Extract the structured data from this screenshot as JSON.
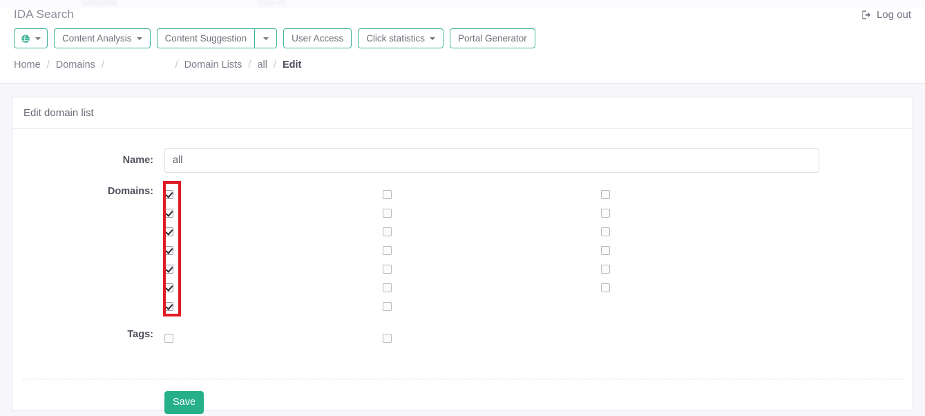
{
  "ghost": {
    "item1": "Unmerkt",
    "item2": "Ctrl+H"
  },
  "header": {
    "brand": "IDA Search",
    "user_email_redacted": "                                  ",
    "logout_label": "Log out",
    "logout_icon": "sign-out-icon"
  },
  "toolbar": {
    "globe_icon": "globe-icon",
    "globe_label": "",
    "buttons": [
      {
        "label": "Content Analysis",
        "caret": true
      },
      {
        "label": "Content Suggestion",
        "caret": false
      },
      {
        "label": "",
        "caret": true
      },
      {
        "label": "User Access",
        "caret": false
      },
      {
        "label": "Click statistics",
        "caret": true
      },
      {
        "label": "Portal Generator",
        "caret": false
      }
    ]
  },
  "breadcrumb": {
    "separator": "/",
    "items": [
      {
        "label": "Home",
        "redacted": false,
        "current": false
      },
      {
        "label": "Domains",
        "redacted": false,
        "current": false
      },
      {
        "label": "                     ",
        "redacted": true,
        "current": false
      },
      {
        "label": "Domain Lists",
        "redacted": false,
        "current": false
      },
      {
        "label": "all",
        "redacted": false,
        "current": false
      },
      {
        "label": "Edit",
        "redacted": false,
        "current": true
      }
    ]
  },
  "panel": {
    "title": "Edit domain list"
  },
  "form": {
    "name": {
      "label": "Name:",
      "value": "all",
      "placeholder": ""
    },
    "domains": {
      "label": "Domains:",
      "columns": [
        {
          "items": [
            {
              "checked": true,
              "label": "                  "
            },
            {
              "checked": true,
              "label": "                    "
            },
            {
              "checked": true,
              "label": "                          "
            },
            {
              "checked": true,
              "label": "                "
            },
            {
              "checked": true,
              "label": "                "
            },
            {
              "checked": true,
              "label": "                 "
            },
            {
              "checked": true,
              "label": "                    "
            }
          ]
        },
        {
          "items": [
            {
              "checked": false,
              "label": "        "
            },
            {
              "checked": false,
              "label": "              "
            },
            {
              "checked": false,
              "label": "                  "
            },
            {
              "checked": false,
              "label": "              "
            },
            {
              "checked": false,
              "label": "            "
            },
            {
              "checked": false,
              "label": "             "
            },
            {
              "checked": false,
              "label": "                       "
            }
          ]
        },
        {
          "items": [
            {
              "checked": false,
              "label": "          "
            },
            {
              "checked": false,
              "label": "              "
            },
            {
              "checked": false,
              "label": "                   "
            },
            {
              "checked": false,
              "label": "                "
            },
            {
              "checked": false,
              "label": "                 "
            },
            {
              "checked": false,
              "label": "                  "
            }
          ]
        }
      ]
    },
    "tags": {
      "label": "Tags:",
      "columns": [
        {
          "items": [
            {
              "checked": false,
              "label": "           "
            }
          ]
        },
        {
          "items": [
            {
              "checked": false,
              "label": "              "
            }
          ]
        }
      ]
    },
    "save_label": "Save"
  },
  "annotation": {
    "redbox_color": "#e01b24"
  },
  "colors": {
    "accent_teal": "#3fb39a",
    "save_green": "#26b08a",
    "text_muted": "#8b8e99",
    "panel_border": "#e4e5ec",
    "page_bg": "#f7f7fb"
  }
}
